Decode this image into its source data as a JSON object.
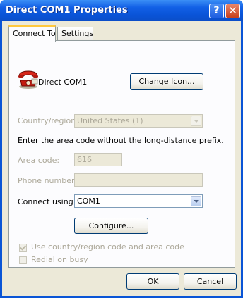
{
  "window": {
    "title": "Direct COM1 Properties",
    "help_button": "?",
    "close_button": "✕"
  },
  "tabs": [
    "Connect To",
    "Settings"
  ],
  "connection": {
    "name": "Direct COM1",
    "change_icon_label": "Change Icon..."
  },
  "country": {
    "label": "Country/region:",
    "value": "United States (1)"
  },
  "instruction": "Enter the area code without the long-distance prefix.",
  "area_code": {
    "label": "Area code:",
    "value": "616"
  },
  "phone_number": {
    "label": "Phone number:",
    "value": ""
  },
  "connect_using": {
    "label": "Connect using:",
    "value": "COM1"
  },
  "configure_label": "Configure...",
  "options": {
    "use_country_area_code": {
      "label": "Use country/region code and area code",
      "checked": true,
      "enabled": false
    },
    "redial_on_busy": {
      "label": "Redial on busy",
      "checked": false,
      "enabled": false
    }
  },
  "footer": {
    "ok_label": "OK",
    "cancel_label": "Cancel"
  },
  "icon_names": [
    "phone-icon",
    "help-icon",
    "close-icon",
    "chevron-down-icon",
    "check-icon"
  ]
}
